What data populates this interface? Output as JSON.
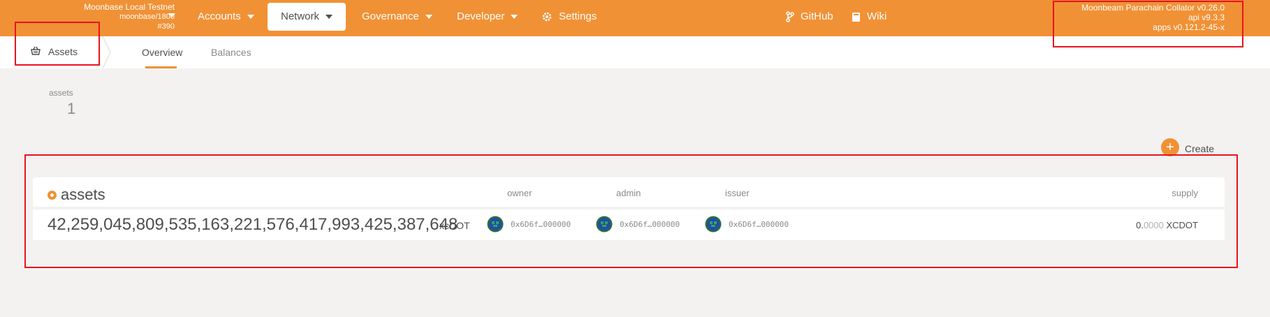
{
  "colors": {
    "accent": "#f19135",
    "highlight": "#e8141b"
  },
  "chain": {
    "name": "Moonbase Local Testnet",
    "runtime": "moonbase/1800",
    "block": "#390"
  },
  "nav": {
    "accounts": "Accounts",
    "network": "Network",
    "governance": "Governance",
    "developer": "Developer",
    "settings": "Settings",
    "github": "GitHub",
    "wiki": "Wiki"
  },
  "version": {
    "node": "Moonbeam Parachain Collator v0.26.0",
    "api": "api v9.3.3",
    "apps": "apps v0.121.2-45-x"
  },
  "subnav": {
    "app_label": "Assets",
    "tabs": [
      "Overview",
      "Balances"
    ]
  },
  "summary": {
    "label": "assets",
    "value": "1"
  },
  "create_label": "Create",
  "table": {
    "title": "assets",
    "headers": {
      "owner": "owner",
      "admin": "admin",
      "issuer": "issuer",
      "supply": "supply"
    },
    "rows": [
      {
        "id": "42,259,045,809,535,163,221,576,417,993,425,387,648",
        "symbol": "xcDOT",
        "owner": "0x6D6f…000000",
        "admin": "0x6D6f…000000",
        "issuer": "0x6D6f…000000",
        "supply_int": "0.",
        "supply_dec": "0000",
        "supply_unit": " XCDOT"
      }
    ]
  }
}
